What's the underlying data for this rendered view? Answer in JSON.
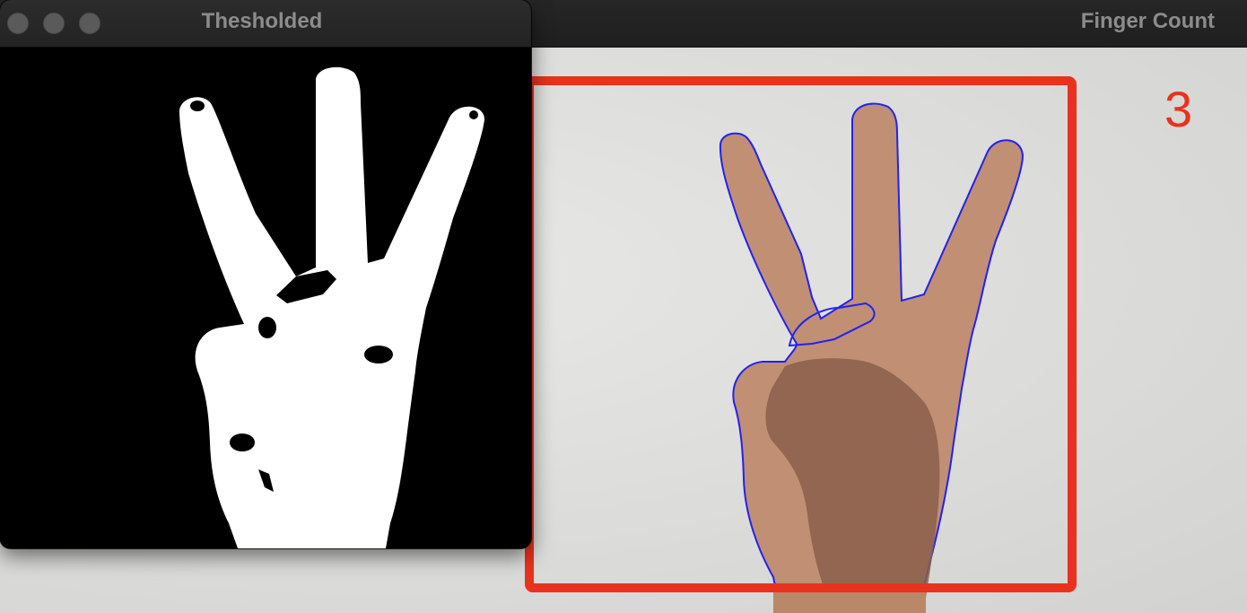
{
  "windows": {
    "finger_count": {
      "title": "Finger Count",
      "finger_count_value": "3",
      "bounding_box_color": "#e8321e",
      "contour_color": "#2222ee",
      "icon": "hand-image"
    },
    "thresholded": {
      "title": "Thesholded",
      "icon": "binary-hand-mask-image"
    }
  }
}
